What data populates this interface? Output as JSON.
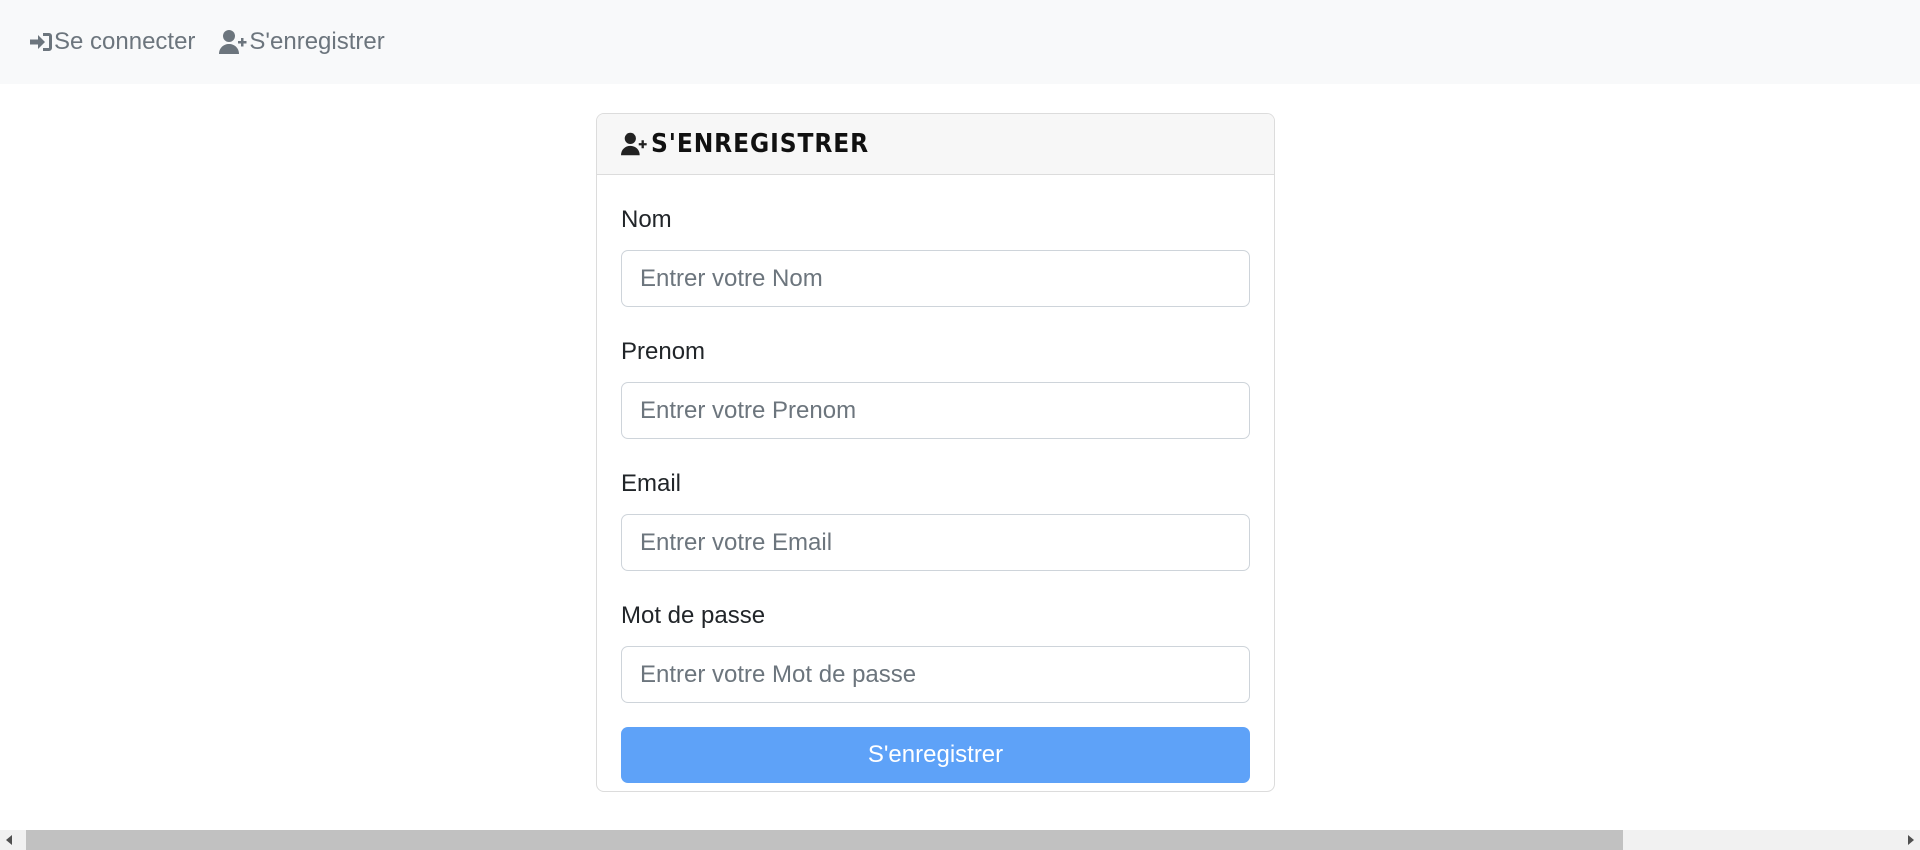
{
  "nav": {
    "login": {
      "label": "Se connecter",
      "icon": "sign-in-icon"
    },
    "register": {
      "label": "S'enregistrer",
      "icon": "user-plus-icon"
    }
  },
  "card": {
    "title": "S'enregistrer",
    "title_icon": "user-plus-icon",
    "fields": [
      {
        "label": "Nom",
        "placeholder": "Entrer votre Nom",
        "value": ""
      },
      {
        "label": "Prenom",
        "placeholder": "Entrer votre Prenom",
        "value": ""
      },
      {
        "label": "Email",
        "placeholder": "Entrer votre Email",
        "value": ""
      },
      {
        "label": "Mot de passe",
        "placeholder": "Entrer votre Mot de passe",
        "value": ""
      }
    ],
    "submit_label": "S'enregistrer"
  },
  "colors": {
    "nav_background": "#f8f9fa",
    "nav_text": "#6c757d",
    "button_background": "#5ea2f8",
    "button_text": "#ffffff",
    "card_header_background": "#f7f7f7"
  },
  "scrollbar": {
    "icons": [
      "scroll-left-arrow-icon",
      "scroll-right-arrow-icon"
    ]
  }
}
